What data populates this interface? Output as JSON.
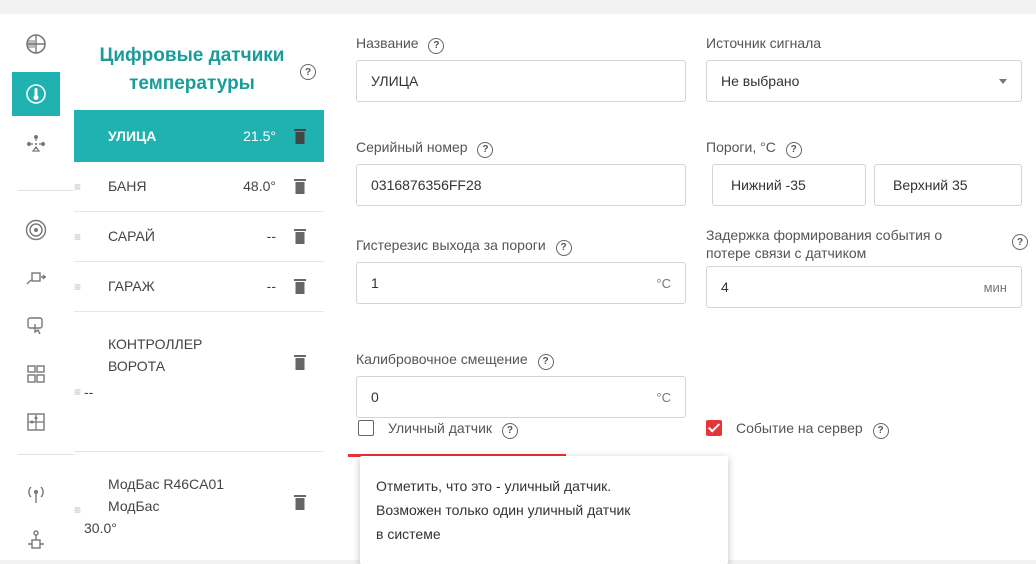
{
  "rail": {
    "icons": [
      "globe-icon",
      "thermometer-icon",
      "sensors-tree-icon",
      "signal-icon",
      "output-icon",
      "gesture-icon",
      "dashboard-icon",
      "puzzle-icon",
      "antenna-icon",
      "network-icon"
    ]
  },
  "list": {
    "title": "Цифровые датчики температуры",
    "help": "?",
    "items": [
      {
        "name": "УЛИЦА",
        "value": "21.5°"
      },
      {
        "name": "БАНЯ",
        "value": "48.0°"
      },
      {
        "name": "САРАЙ",
        "value": "--"
      },
      {
        "name": "ГАРАЖ",
        "value": "--"
      },
      {
        "name_line1": "КОНТРОЛЛЕР",
        "name_line2": "ВОРОТА",
        "value": "--"
      },
      {
        "name_line1": "МодБас R46CA01",
        "name_line2": "МодБас",
        "value": "30.0°"
      }
    ]
  },
  "form": {
    "name_label": "Название",
    "name_value": "УЛИЦА",
    "source_label": "Источник сигнала",
    "source_value": "Не выбрано",
    "serial_label": "Серийный номер",
    "serial_value": "0316876356FF28",
    "thresholds_label": "Пороги, °C",
    "lower_value": "Нижний -35",
    "upper_value": "Верхний 35",
    "hysteresis_label": "Гистерезис выхода за пороги",
    "hysteresis_value": "1",
    "hysteresis_unit": "°C",
    "delay_label_line1": "Задержка формирования события о",
    "delay_label_line2": "потере связи с датчиком",
    "delay_value": "4",
    "delay_unit": "мин",
    "calib_label": "Калибровочное смещение",
    "calib_value": "0",
    "calib_unit": "°C",
    "street_label": "Уличный датчик",
    "street_checked": false,
    "event_label": "Событие на сервер",
    "event_checked": true,
    "help": "?"
  },
  "tooltip": {
    "line1": "Отметить, что это - уличный датчик.",
    "line2": "Возможен только один уличный датчик",
    "line3": "в системе"
  },
  "colors": {
    "accent": "#20b2b0",
    "danger": "#e5343a"
  }
}
